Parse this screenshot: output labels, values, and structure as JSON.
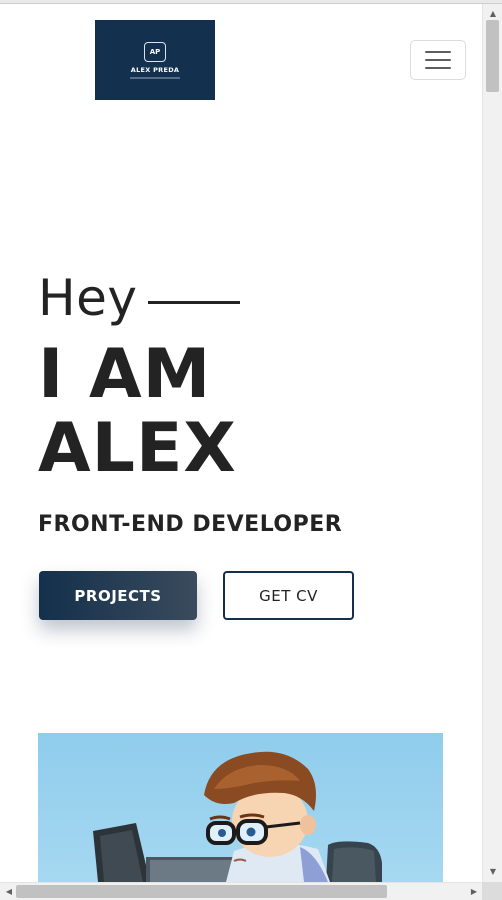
{
  "header": {
    "logo": {
      "monogram": "AP",
      "name": "ALEX PREDA",
      "tagline": "",
      "background_color": "#13304e"
    },
    "menu_icon": "hamburger-menu-icon"
  },
  "hero": {
    "greeting": "Hey",
    "headline_line1": "I AM",
    "headline_line2": "ALEX",
    "role": "FRONT-END DEVELOPER",
    "projects_button": "PROJECTS",
    "cv_button": "GET CV",
    "accent_color": "#14304c",
    "text_color": "#232323"
  },
  "illustration": {
    "description_icon": "developer-cartoon-illustration",
    "background_color": "#9dd4f0"
  },
  "scrollbars": {
    "up_icon": "▲",
    "down_icon": "▼",
    "left_icon": "◀",
    "right_icon": "▶"
  }
}
